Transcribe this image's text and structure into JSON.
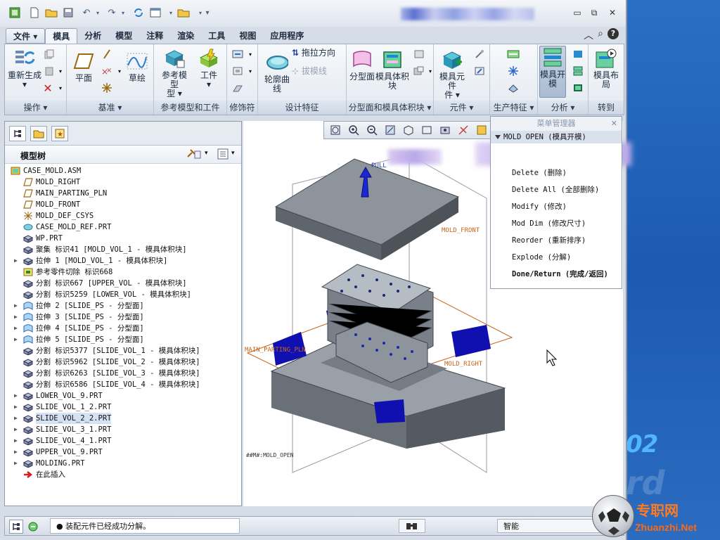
{
  "window": {
    "minimize": "▭",
    "restore": "⧉",
    "close": "✕"
  },
  "tabs": [
    "文件",
    "模具",
    "分析",
    "模型",
    "注释",
    "渲染",
    "工具",
    "视图",
    "应用程序"
  ],
  "ribbon": {
    "groups": [
      {
        "label": "操作 ▾"
      },
      {
        "label": "基准 ▾"
      },
      {
        "label": "参考模型和工件"
      },
      {
        "label": "修饰符"
      },
      {
        "label": "设计特征"
      },
      {
        "label": "分型面和模具体积块 ▾"
      },
      {
        "label": "元件 ▾"
      },
      {
        "label": "生产特征 ▾"
      },
      {
        "label": "分析 ▾"
      },
      {
        "label": "转到"
      }
    ],
    "buttons": {
      "regenerate": "重新生成",
      "plane": "平面",
      "sketch": "草绘",
      "ref_model": "参考模型",
      "workpiece": "工件",
      "profile_curve": "轮廓曲线",
      "pull_direction": "拖拉方向",
      "draft_line": "拔模线",
      "parting_surface": "分型面",
      "mold_volume": "模具体积块",
      "mold_component": "模具元件",
      "mold_open": "模具开模",
      "mold_layout": "模具布局"
    }
  },
  "tree": {
    "title": "模型树",
    "items": [
      {
        "label": "CASE_MOLD.ASM",
        "level": 0,
        "expand": false,
        "icon": "asm"
      },
      {
        "label": "MOLD_RIGHT",
        "level": 1,
        "expand": false,
        "icon": "plane"
      },
      {
        "label": "MAIN_PARTING_PLN",
        "level": 1,
        "expand": false,
        "icon": "plane"
      },
      {
        "label": "MOLD_FRONT",
        "level": 1,
        "expand": false,
        "icon": "plane"
      },
      {
        "label": "MOLD_DEF_CSYS",
        "level": 1,
        "expand": false,
        "icon": "csys"
      },
      {
        "label": "CASE_MOLD_REF.PRT",
        "level": 1,
        "expand": false,
        "icon": "refprt"
      },
      {
        "label": "WP.PRT",
        "level": 1,
        "expand": false,
        "icon": "part"
      },
      {
        "label": "聚集 标识41 [MOLD_VOL_1 - 模具体积块]",
        "level": 1,
        "expand": false,
        "icon": "part"
      },
      {
        "label": "拉伸 1 [MOLD_VOL_1 - 模具体积块]",
        "level": 1,
        "expand": true,
        "icon": "part"
      },
      {
        "label": "参考零件切除 标识668",
        "level": 1,
        "expand": false,
        "icon": "cut"
      },
      {
        "label": "分割 标识667 [UPPER_VOL - 模具体积块]",
        "level": 1,
        "expand": false,
        "icon": "part"
      },
      {
        "label": "分割 标识5259 [LOWER_VOL - 模具体积块]",
        "level": 1,
        "expand": false,
        "icon": "part"
      },
      {
        "label": "拉伸 2 [SLIDE_PS - 分型面]",
        "level": 1,
        "expand": true,
        "icon": "surf"
      },
      {
        "label": "拉伸 3 [SLIDE_PS - 分型面]",
        "level": 1,
        "expand": true,
        "icon": "surf"
      },
      {
        "label": "拉伸 4 [SLIDE_PS - 分型面]",
        "level": 1,
        "expand": true,
        "icon": "surf"
      },
      {
        "label": "拉伸 5 [SLIDE_PS - 分型面]",
        "level": 1,
        "expand": true,
        "icon": "surf"
      },
      {
        "label": "分割 标识5377 [SLIDE_VOL_1 - 模具体积块]",
        "level": 1,
        "expand": false,
        "icon": "part"
      },
      {
        "label": "分割 标识5962 [SLIDE_VOL_2 - 模具体积块]",
        "level": 1,
        "expand": false,
        "icon": "part"
      },
      {
        "label": "分割 标识6263 [SLIDE_VOL_3 - 模具体积块]",
        "level": 1,
        "expand": false,
        "icon": "part"
      },
      {
        "label": "分割 标识6586 [SLIDE_VOL_4 - 模具体积块]",
        "level": 1,
        "expand": false,
        "icon": "part"
      },
      {
        "label": "LOWER_VOL_9.PRT",
        "level": 1,
        "expand": true,
        "icon": "part"
      },
      {
        "label": "SLIDE_VOL_1_2.PRT",
        "level": 1,
        "expand": true,
        "icon": "part"
      },
      {
        "label": "SLIDE_VOL_2_2.PRT",
        "level": 1,
        "expand": true,
        "icon": "part",
        "highlight": true
      },
      {
        "label": "SLIDE_VOL_3_1.PRT",
        "level": 1,
        "expand": true,
        "icon": "part"
      },
      {
        "label": "SLIDE_VOL_4_1.PRT",
        "level": 1,
        "expand": true,
        "icon": "part"
      },
      {
        "label": "UPPER_VOL_9.PRT",
        "level": 1,
        "expand": true,
        "icon": "part"
      },
      {
        "label": "MOLDING.PRT",
        "level": 1,
        "expand": true,
        "icon": "part"
      },
      {
        "label": "在此插入",
        "level": 1,
        "expand": false,
        "icon": "insert"
      }
    ]
  },
  "graphics": {
    "pull_label": "PULL",
    "mold_front": "MOLD_FRONT",
    "main_parting": "MAIN_PARTING_PLN",
    "mold_right": "MOLD_RIGHT",
    "view_label": "##M#:MOLD_OPEN"
  },
  "menu_manager": {
    "title": "菜单管理器",
    "header": "MOLD OPEN (模具开模)",
    "items": [
      "Delete (删除)",
      "Delete All (全部删除)",
      "Modify (修改)",
      "Mod Dim (修改尺寸)",
      "Reorder (重新排序)",
      "Explode (分解)",
      "Done/Return (完成/返回)"
    ]
  },
  "status": {
    "message": "● 装配元件已经成功分解。",
    "mode": "智能"
  },
  "desktop": {
    "number": "02",
    "ghost": "rd"
  },
  "watermark": {
    "site": "专职网",
    "url": "Zhuanzhi.Net"
  },
  "colors": {
    "accent": "#1e3fa0",
    "mold_gray": "#7a8089",
    "slide_blue": "#1010b0",
    "datum_orange": "#c8641e"
  }
}
